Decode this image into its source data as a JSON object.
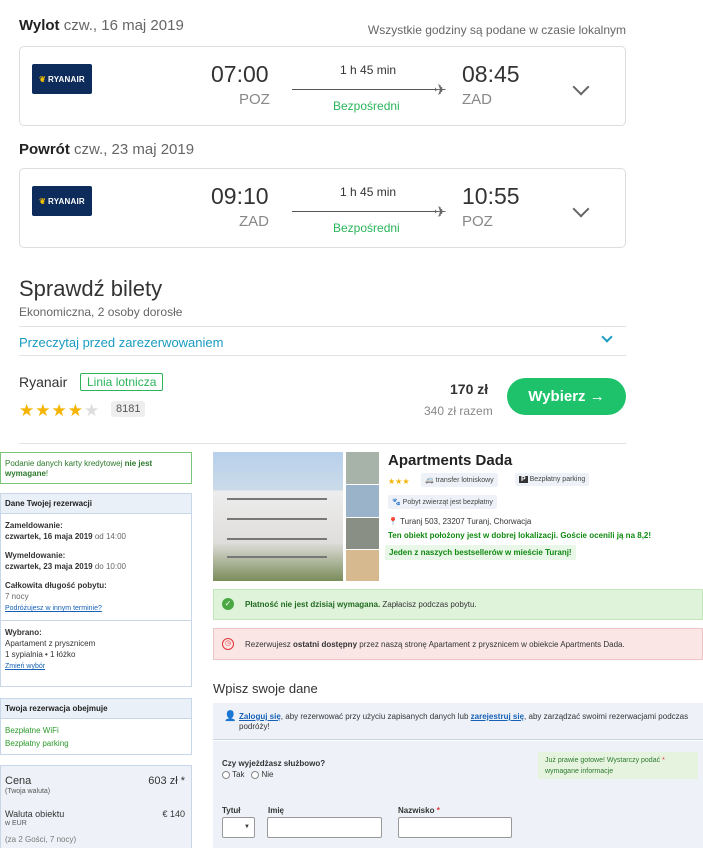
{
  "departure": {
    "label": "Wylot",
    "date": "czw., 16 maj 2019",
    "timezone_note": "Wszystkie godziny są podane w czasie lokalnym",
    "airline": "RYANAIR",
    "dep_time": "07:00",
    "dep_code": "POZ",
    "duration": "1 h 45 min",
    "type": "Bezpośredni",
    "arr_time": "08:45",
    "arr_code": "ZAD"
  },
  "return": {
    "label": "Powrót",
    "date": "czw., 23 maj 2019",
    "airline": "RYANAIR",
    "dep_time": "09:10",
    "dep_code": "ZAD",
    "duration": "1 h 45 min",
    "type": "Bezpośredni",
    "arr_time": "10:55",
    "arr_code": "POZ"
  },
  "tickets": {
    "title": "Sprawdź bilety",
    "subtitle": "Ekonomiczna, 2 osoby dorosłe",
    "read_before": "Przeczytaj przed zarezerwowaniem",
    "provider": "Ryanair",
    "provider_badge": "Linia lotnicza",
    "rating_stars": 4,
    "reviews": "8181",
    "price": "170 zł",
    "per_person": "340 zł razem",
    "button": "Wybierz →"
  },
  "booking": {
    "cc_notice_pre": "Podanie danych karty kredytowej ",
    "cc_notice_bold": "nie jest wymagane",
    "cc_notice_post": "!",
    "details_header": "Dane Twojej rezerwacji",
    "checkin_label": "Zameldowanie:",
    "checkin_date": "czwartek, 16 maja 2019",
    "checkin_time": "od 14:00",
    "checkout_label": "Wymeldowanie:",
    "checkout_date": "czwartek, 23 maja 2019",
    "checkout_time": "do 10:00",
    "length_label": "Całkowita długość pobytu:",
    "length_value": "7 nocy",
    "other_date": "Podróżujesz w innym terminie?",
    "chosen_label": "Wybrano:",
    "room": "Apartament z prysznicem",
    "room_details": "1 sypialnia • 1 łóżko",
    "change_choice": "Zmień wybór",
    "includes_header": "Twoja rezerwacja obejmuje",
    "include_1": "Bezpłatne WiFi",
    "include_2": "Bezpłatny parking",
    "price_label": "Cena",
    "price_sub": "(Twoja waluta)",
    "price_value": "603 zł *",
    "currency_label": "Waluta obiektu",
    "currency_sub": "w EUR",
    "currency_value": "€ 140",
    "guests": "(za 2 Gości, 7 nocy)"
  },
  "hotel": {
    "name": "Apartments Dada",
    "tag_transfer": "transfer lotniskowy",
    "tag_parking": "Bezpłatny parking",
    "tag_pets": "Pobyt zwierząt jest bezpłatny",
    "address": "Turanj 503, 23207 Turanj, Chorwacja",
    "location_note": "Ten obiekt położony jest w dobrej lokalizacji. Goście ocenili ją na 8,2!",
    "bestseller": "Jeden z naszych bestsellerów w mieście Turanj!"
  },
  "alerts": {
    "payment_bold": "Płatność nie jest dzisiaj wymagana.",
    "payment_rest": " Zapłacisz podczas pobytu.",
    "last_pre": "Rezerwujesz ",
    "last_bold": "ostatni dostępny",
    "last_post": " przez naszą stronę Apartament z prysznicem w obiekcie Apartments Dada."
  },
  "form": {
    "title": "Wpisz swoje dane",
    "login": "Zaloguj się",
    "login_text": ", aby rezerwować przy użyciu zapisanych danych lub ",
    "register": "zarejestruj się",
    "register_text": ", aby zarządzać swoimi rezerwacjami podczas podróży!",
    "business_q": "Czy wyjeżdżasz służbowo?",
    "yes": "Tak",
    "no": "Nie",
    "almost": "Już prawie gotowe! Wystarczy podać",
    "almost_star": "*",
    "almost_2": "wymagane informacje",
    "title_lbl": "Tytuł",
    "first_lbl": "Imię",
    "last_lbl": "Nazwisko",
    "req": "*"
  },
  "colors": {
    "green": "#1dc26a",
    "blue_link": "#1660b6",
    "navy": "#0d2c5b"
  }
}
